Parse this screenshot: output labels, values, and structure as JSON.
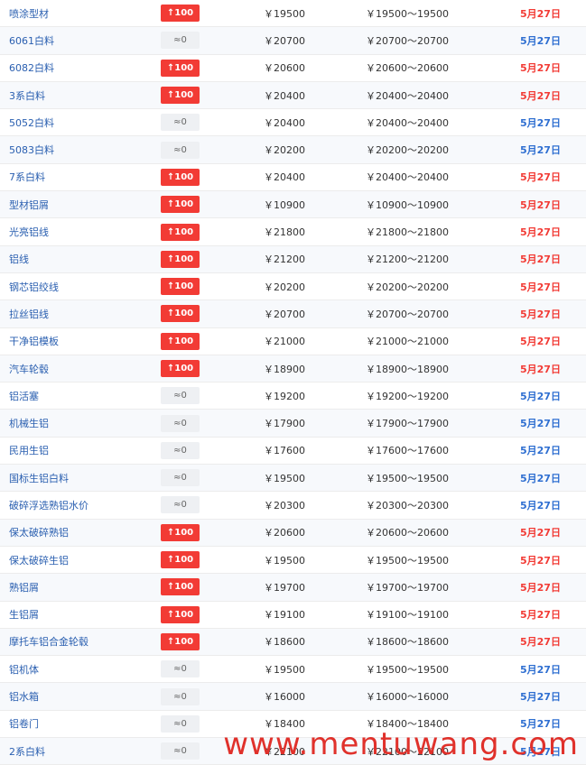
{
  "colors": {
    "up_badge": "#f23b35",
    "flat_badge": "#eef0f3",
    "date_red": "#f23b35",
    "date_blue": "#2f6fd1",
    "link_blue": "#2a5fb0"
  },
  "rows": [
    {
      "name": "喷涂型材",
      "change": "↑100",
      "dir": "up",
      "price": "￥19500",
      "range": "￥19500～19500",
      "date": "5月27日",
      "date_color": "red"
    },
    {
      "name": "6061白料",
      "change": "≈0",
      "dir": "flat",
      "price": "￥20700",
      "range": "￥20700～20700",
      "date": "5月27日",
      "date_color": "blue"
    },
    {
      "name": "6082白料",
      "change": "↑100",
      "dir": "up",
      "price": "￥20600",
      "range": "￥20600～20600",
      "date": "5月27日",
      "date_color": "red"
    },
    {
      "name": "3系白料",
      "change": "↑100",
      "dir": "up",
      "price": "￥20400",
      "range": "￥20400～20400",
      "date": "5月27日",
      "date_color": "red"
    },
    {
      "name": "5052白料",
      "change": "≈0",
      "dir": "flat",
      "price": "￥20400",
      "range": "￥20400～20400",
      "date": "5月27日",
      "date_color": "blue"
    },
    {
      "name": "5083白料",
      "change": "≈0",
      "dir": "flat",
      "price": "￥20200",
      "range": "￥20200～20200",
      "date": "5月27日",
      "date_color": "blue"
    },
    {
      "name": "7系白料",
      "change": "↑100",
      "dir": "up",
      "price": "￥20400",
      "range": "￥20400～20400",
      "date": "5月27日",
      "date_color": "red"
    },
    {
      "name": "型材铝屑",
      "change": "↑100",
      "dir": "up",
      "price": "￥10900",
      "range": "￥10900～10900",
      "date": "5月27日",
      "date_color": "red"
    },
    {
      "name": "光亮铝线",
      "change": "↑100",
      "dir": "up",
      "price": "￥21800",
      "range": "￥21800～21800",
      "date": "5月27日",
      "date_color": "red"
    },
    {
      "name": "铝线",
      "change": "↑100",
      "dir": "up",
      "price": "￥21200",
      "range": "￥21200～21200",
      "date": "5月27日",
      "date_color": "red"
    },
    {
      "name": "钢芯铝绞线",
      "change": "↑100",
      "dir": "up",
      "price": "￥20200",
      "range": "￥20200～20200",
      "date": "5月27日",
      "date_color": "red"
    },
    {
      "name": "拉丝铝线",
      "change": "↑100",
      "dir": "up",
      "price": "￥20700",
      "range": "￥20700～20700",
      "date": "5月27日",
      "date_color": "red"
    },
    {
      "name": "干净铝模板",
      "change": "↑100",
      "dir": "up",
      "price": "￥21000",
      "range": "￥21000～21000",
      "date": "5月27日",
      "date_color": "red"
    },
    {
      "name": "汽车轮毂",
      "change": "↑100",
      "dir": "up",
      "price": "￥18900",
      "range": "￥18900～18900",
      "date": "5月27日",
      "date_color": "red"
    },
    {
      "name": "铝活塞",
      "change": "≈0",
      "dir": "flat",
      "price": "￥19200",
      "range": "￥19200～19200",
      "date": "5月27日",
      "date_color": "blue"
    },
    {
      "name": "机械生铝",
      "change": "≈0",
      "dir": "flat",
      "price": "￥17900",
      "range": "￥17900～17900",
      "date": "5月27日",
      "date_color": "blue"
    },
    {
      "name": "民用生铝",
      "change": "≈0",
      "dir": "flat",
      "price": "￥17600",
      "range": "￥17600～17600",
      "date": "5月27日",
      "date_color": "blue"
    },
    {
      "name": "国标生铝白料",
      "change": "≈0",
      "dir": "flat",
      "price": "￥19500",
      "range": "￥19500～19500",
      "date": "5月27日",
      "date_color": "blue"
    },
    {
      "name": "破碎浮选熟铝水价",
      "change": "≈0",
      "dir": "flat",
      "price": "￥20300",
      "range": "￥20300～20300",
      "date": "5月27日",
      "date_color": "blue"
    },
    {
      "name": "保太破碎熟铝",
      "change": "↑100",
      "dir": "up",
      "price": "￥20600",
      "range": "￥20600～20600",
      "date": "5月27日",
      "date_color": "red"
    },
    {
      "name": "保太破碎生铝",
      "change": "↑100",
      "dir": "up",
      "price": "￥19500",
      "range": "￥19500～19500",
      "date": "5月27日",
      "date_color": "red"
    },
    {
      "name": "熟铝屑",
      "change": "↑100",
      "dir": "up",
      "price": "￥19700",
      "range": "￥19700～19700",
      "date": "5月27日",
      "date_color": "red"
    },
    {
      "name": "生铝屑",
      "change": "↑100",
      "dir": "up",
      "price": "￥19100",
      "range": "￥19100～19100",
      "date": "5月27日",
      "date_color": "red"
    },
    {
      "name": "摩托车铝合金轮毂",
      "change": "↑100",
      "dir": "up",
      "price": "￥18600",
      "range": "￥18600～18600",
      "date": "5月27日",
      "date_color": "red"
    },
    {
      "name": "铝机体",
      "change": "≈0",
      "dir": "flat",
      "price": "￥19500",
      "range": "￥19500～19500",
      "date": "5月27日",
      "date_color": "blue"
    },
    {
      "name": "铝水箱",
      "change": "≈0",
      "dir": "flat",
      "price": "￥16000",
      "range": "￥16000～16000",
      "date": "5月27日",
      "date_color": "blue"
    },
    {
      "name": "铝卷门",
      "change": "≈0",
      "dir": "flat",
      "price": "￥18400",
      "range": "￥18400～18400",
      "date": "5月27日",
      "date_color": "blue"
    },
    {
      "name": "2系白料",
      "change": "≈0",
      "dir": "flat",
      "price": "￥22100",
      "range": "￥22100～22100",
      "date": "5月27日",
      "date_color": "blue"
    }
  ],
  "watermark": {
    "text": "www.mentuwang.com",
    "color": "#e0312b"
  }
}
